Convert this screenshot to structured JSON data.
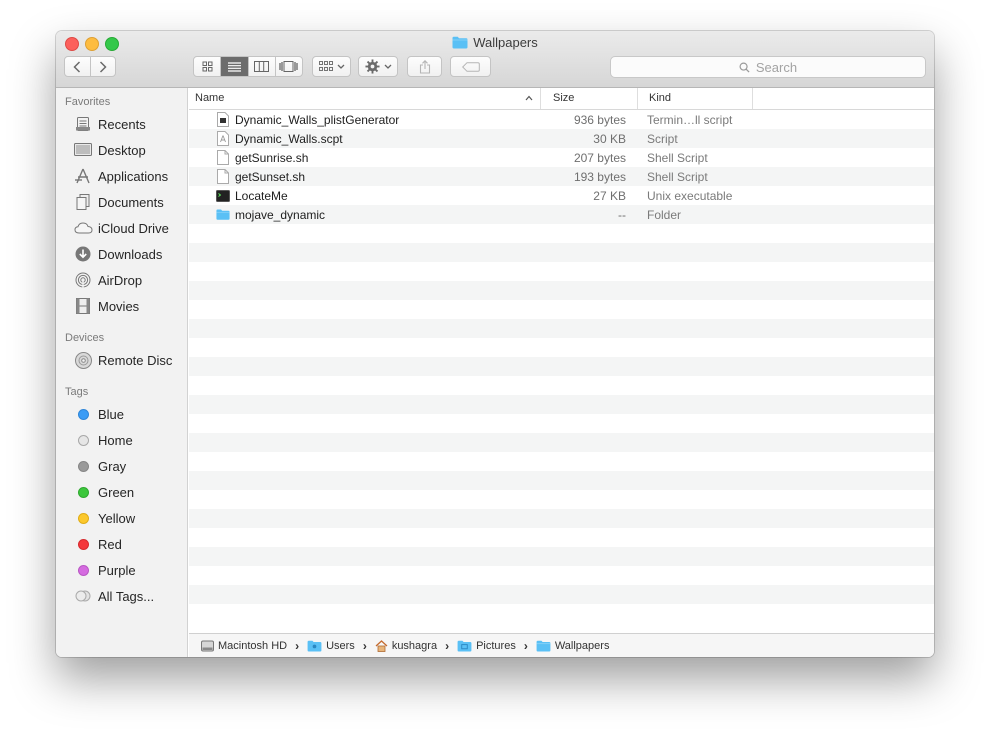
{
  "window": {
    "title": "Wallpapers"
  },
  "toolbar": {
    "search_placeholder": "Search"
  },
  "sidebar": {
    "favorites_heading": "Favorites",
    "favorites": [
      {
        "label": "Recents",
        "icon": "recents-icon"
      },
      {
        "label": "Desktop",
        "icon": "desktop-icon"
      },
      {
        "label": "Applications",
        "icon": "applications-icon"
      },
      {
        "label": "Documents",
        "icon": "documents-icon"
      },
      {
        "label": "iCloud Drive",
        "icon": "icloud-icon"
      },
      {
        "label": "Downloads",
        "icon": "downloads-icon"
      },
      {
        "label": "AirDrop",
        "icon": "airdrop-icon"
      },
      {
        "label": "Movies",
        "icon": "movies-icon"
      }
    ],
    "devices_heading": "Devices",
    "devices": [
      {
        "label": "Remote Disc",
        "icon": "disc-icon"
      }
    ],
    "tags_heading": "Tags",
    "tags": [
      {
        "label": "Blue",
        "color": "#3b9cf5"
      },
      {
        "label": "Home",
        "color": "#e6e6e6"
      },
      {
        "label": "Gray",
        "color": "#9a9a9a"
      },
      {
        "label": "Green",
        "color": "#3cc73c"
      },
      {
        "label": "Yellow",
        "color": "#fcc82c"
      },
      {
        "label": "Red",
        "color": "#f4373b"
      },
      {
        "label": "Purple",
        "color": "#d56be0"
      },
      {
        "label": "All Tags...",
        "color": "#e3e3e3"
      }
    ]
  },
  "columns": {
    "name": "Name",
    "size": "Size",
    "kind": "Kind"
  },
  "files": [
    {
      "name": "Dynamic_Walls_plistGenerator",
      "size": "936 bytes",
      "kind": "Termin…ll script",
      "icon": "terminal-script-icon"
    },
    {
      "name": "Dynamic_Walls.scpt",
      "size": "30 KB",
      "kind": "Script",
      "icon": "applescript-icon"
    },
    {
      "name": "getSunrise.sh",
      "size": "207 bytes",
      "kind": "Shell Script",
      "icon": "document-icon"
    },
    {
      "name": "getSunset.sh",
      "size": "193 bytes",
      "kind": "Shell Script",
      "icon": "document-icon"
    },
    {
      "name": "LocateMe",
      "size": "27 KB",
      "kind": "Unix executable",
      "icon": "executable-icon"
    },
    {
      "name": "mojave_dynamic",
      "size": "--",
      "kind": "Folder",
      "icon": "folder-icon"
    }
  ],
  "pathbar": [
    {
      "label": "Macintosh HD",
      "icon": "hard-drive-icon"
    },
    {
      "label": "Users",
      "icon": "folder-icon"
    },
    {
      "label": "kushagra",
      "icon": "home-icon"
    },
    {
      "label": "Pictures",
      "icon": "folder-icon"
    },
    {
      "label": "Wallpapers",
      "icon": "folder-icon"
    }
  ],
  "colors": {
    "folder": "#5ac0f5",
    "selected_view": "#6c6c6c",
    "stripe": "#f4f5f5"
  }
}
